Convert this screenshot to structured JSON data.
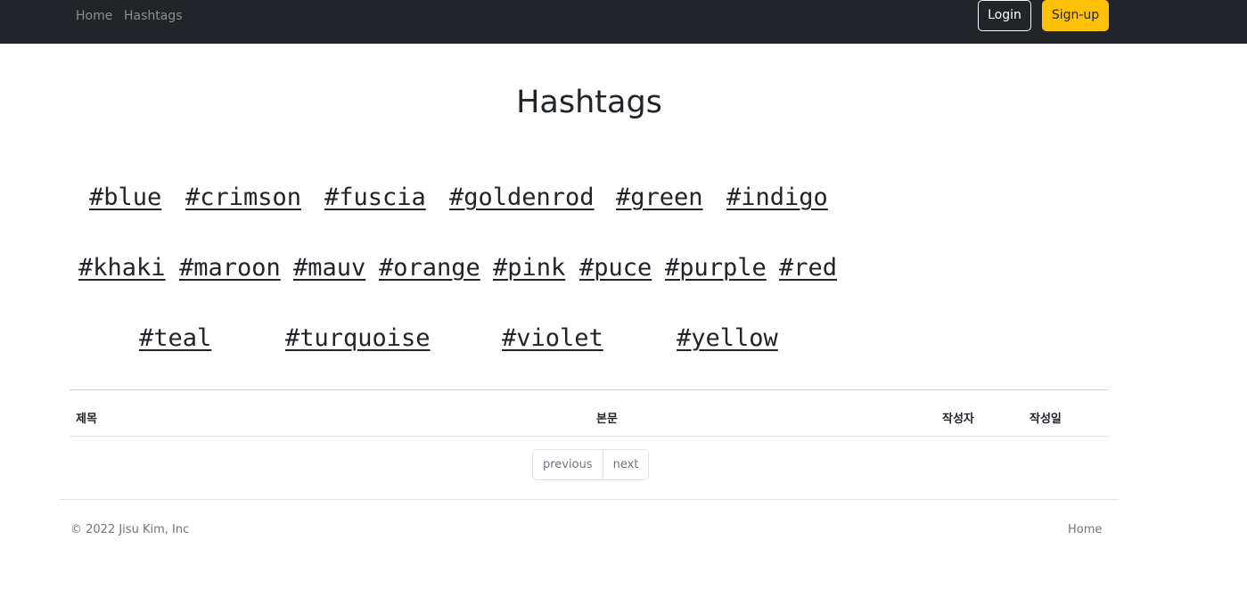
{
  "nav": {
    "links": [
      "Home",
      "Hashtags"
    ],
    "login_label": "Login",
    "signup_label": "Sign-up"
  },
  "page": {
    "title": "Hashtags"
  },
  "hashtags": [
    "#blue",
    "#crimson",
    "#fuscia",
    "#goldenrod",
    "#green",
    "#indigo",
    "#khaki",
    "#maroon",
    "#mauv",
    "#orange",
    "#pink",
    "#puce",
    "#purple",
    "#red",
    "#teal",
    "#turquoise",
    "#violet",
    "#yellow"
  ],
  "table": {
    "headers": [
      "제목",
      "본문",
      "작성자",
      "작성일"
    ]
  },
  "pagination": {
    "previous": "previous",
    "next": "next"
  },
  "footer": {
    "copyright": "© 2022 Jisu Kim, Inc",
    "home_link": "Home"
  },
  "colors": {
    "navbar_bg": "#212529",
    "signup_bg": "#ffc107"
  }
}
